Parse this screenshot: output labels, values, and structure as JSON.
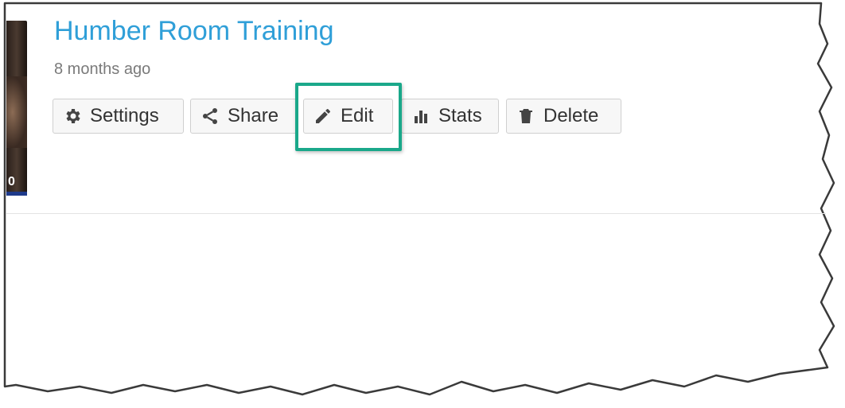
{
  "video": {
    "title": "Humber Room Training",
    "meta": "8 months ago",
    "duration_fragment": "0"
  },
  "actions": [
    {
      "label": "Settings",
      "icon": "gear-icon"
    },
    {
      "label": "Share",
      "icon": "share-icon"
    },
    {
      "label": "Edit",
      "icon": "pencil-icon"
    },
    {
      "label": "Stats",
      "icon": "bar-chart-icon"
    },
    {
      "label": "Delete",
      "icon": "trash-icon"
    }
  ],
  "colors": {
    "title": "#2f9fd8",
    "highlight": "#1aa88a",
    "meta_text": "#7a7a7a"
  }
}
